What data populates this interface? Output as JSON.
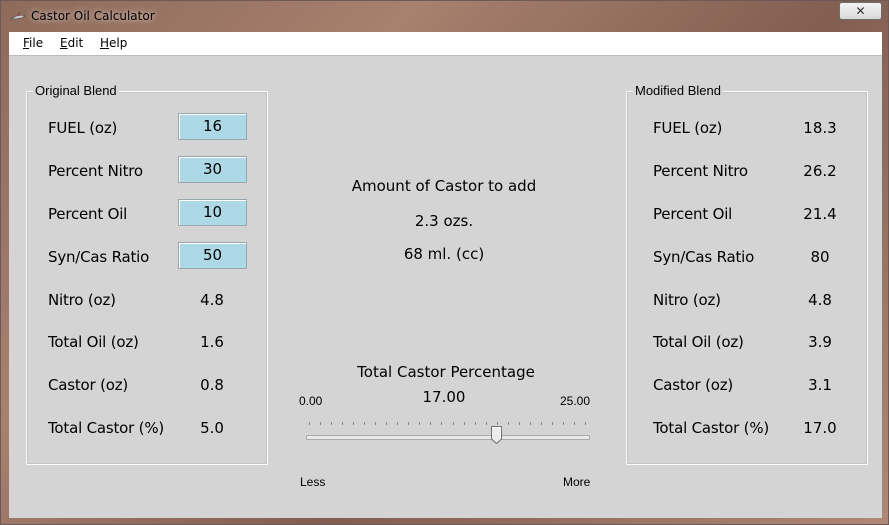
{
  "window": {
    "title": "Castor Oil Calculator",
    "close_glyph": "✕"
  },
  "menu": [
    {
      "accel": "F",
      "rest": "ile"
    },
    {
      "accel": "E",
      "rest": "dit"
    },
    {
      "accel": "H",
      "rest": "elp"
    }
  ],
  "original": {
    "title": "Original Blend",
    "fuel_label": "FUEL (oz)",
    "fuel_value": "16",
    "nitro_pct_label": "Percent Nitro",
    "nitro_pct_value": "30",
    "oil_pct_label": "Percent Oil",
    "oil_pct_value": "10",
    "syncas_label": "Syn/Cas Ratio",
    "syncas_value": "50",
    "nitro_oz_label": "Nitro (oz)",
    "nitro_oz_value": "4.8",
    "total_oil_label": "Total Oil (oz)",
    "total_oil_value": "1.6",
    "castor_oz_label": "Castor (oz)",
    "castor_oz_value": "0.8",
    "total_castor_label": "Total Castor (%)",
    "total_castor_value": "5.0"
  },
  "modified": {
    "title": "Modified Blend",
    "fuel_label": "FUEL (oz)",
    "fuel_value": "18.3",
    "nitro_pct_label": "Percent Nitro",
    "nitro_pct_value": "26.2",
    "oil_pct_label": "Percent Oil",
    "oil_pct_value": "21.4",
    "syncas_label": "Syn/Cas Ratio",
    "syncas_value": "80",
    "nitro_oz_label": "Nitro (oz)",
    "nitro_oz_value": "4.8",
    "total_oil_label": "Total Oil (oz)",
    "total_oil_value": "3.9",
    "castor_oz_label": "Castor (oz)",
    "castor_oz_value": "3.1",
    "total_castor_label": "Total Castor (%)",
    "total_castor_value": "17.0"
  },
  "center": {
    "amount_heading": "Amount of Castor to add",
    "amount_ozs": "2.3 ozs.",
    "amount_ml": "68 ml. (cc)",
    "slider_heading": "Total Castor Percentage",
    "slider_min": "0.00",
    "slider_max": "25.00",
    "slider_value": "17.00",
    "slider_value_num": 17,
    "slider_min_num": 0,
    "slider_max_num": 25,
    "less_label": "Less",
    "more_label": "More"
  },
  "colors": {
    "input_bg": "#add8e6",
    "client_bg": "#d4d4d4"
  }
}
